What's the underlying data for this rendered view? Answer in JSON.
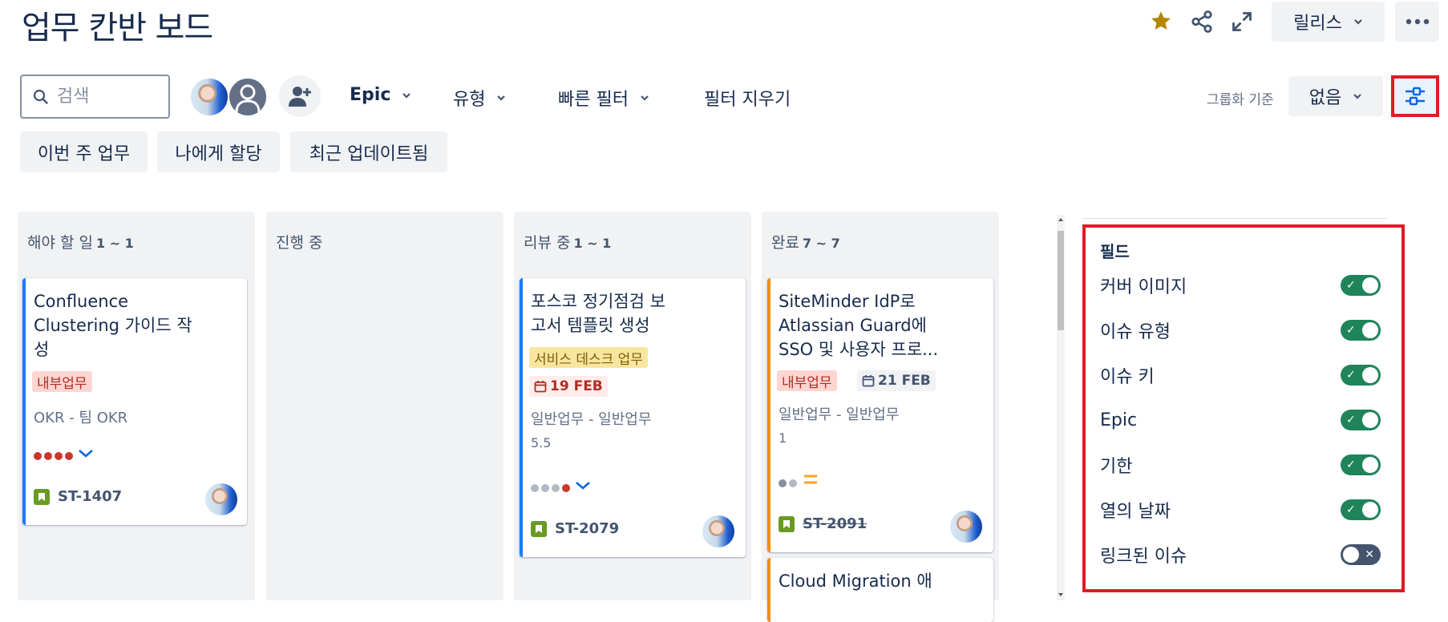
{
  "header": {
    "title": "업무 칸반 보드",
    "release_label": "릴리스",
    "icons": [
      "star-icon",
      "share-icon",
      "expand-icon",
      "chevron-down-icon",
      "more-icon"
    ],
    "star_color": "#b38600"
  },
  "toolbar": {
    "search_placeholder": "검색",
    "filters": {
      "epic": "Epic",
      "type": "유형",
      "quick": "빠른 필터",
      "clear": "필터 지우기"
    },
    "group_by_label": "그룹화 기준",
    "group_by_value": "없음"
  },
  "quick_chips": [
    "이번 주 업무",
    "나에게 할당",
    "최근 업데이트됨"
  ],
  "columns": [
    {
      "title": "해야 할 일",
      "count": "1 ~ 1"
    },
    {
      "title": "진행 중",
      "count": ""
    },
    {
      "title": "리뷰 중",
      "count": "1 ~ 1"
    },
    {
      "title": "완료",
      "count": "7 ~ 7"
    }
  ],
  "cards": {
    "c1": {
      "title_lines": [
        "Confluence",
        "Clustering 가이드 작",
        "성"
      ],
      "label": "내부업무",
      "epic": "OKR - 팀 OKR",
      "key": "ST-1407",
      "accent": "#1d7afc"
    },
    "c2": {
      "title_lines": [
        "포스코 정기점검 보",
        "고서 템플릿 생성"
      ],
      "label": "서비스 데스크 업무",
      "due": "19 FEB",
      "epic": "일반업무 - 일반업무",
      "estimate": "5.5",
      "key": "ST-2079",
      "accent": "#1d7afc"
    },
    "c3": {
      "title_lines": [
        "SiteMinder IdP로",
        "Atlassian Guard에",
        "SSO 및 사용자 프로..."
      ],
      "label": "내부업무",
      "due": "21 FEB",
      "epic": "일반업무 - 일반업무",
      "estimate": "1",
      "key": "ST-2091",
      "accent": "#f18d13"
    },
    "c4": {
      "title_lines": [
        "Cloud Migration 애"
      ],
      "accent": "#f18d13"
    }
  },
  "fields_panel": {
    "title": "필드",
    "items": [
      {
        "label": "커버 이미지",
        "on": true
      },
      {
        "label": "이슈 유형",
        "on": true
      },
      {
        "label": "이슈 키",
        "on": true
      },
      {
        "label": "Epic",
        "on": true
      },
      {
        "label": "기한",
        "on": true
      },
      {
        "label": "열의 날짜",
        "on": true
      },
      {
        "label": "링크된 이슈",
        "on": false
      }
    ],
    "highlight_color": "#e01b24"
  }
}
